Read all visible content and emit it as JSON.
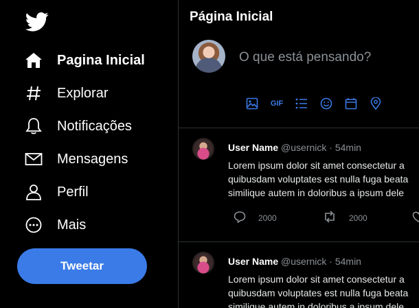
{
  "sidebar": {
    "logo": "twitter-bird-icon",
    "items": [
      {
        "label": "Pagina Inicial",
        "icon": "home-icon",
        "active": true
      },
      {
        "label": "Explorar",
        "icon": "hashtag-icon"
      },
      {
        "label": "Notificações",
        "icon": "bell-icon"
      },
      {
        "label": "Mensagens",
        "icon": "mail-icon"
      },
      {
        "label": "Perfil",
        "icon": "user-icon"
      },
      {
        "label": "Mais",
        "icon": "more-circle-icon"
      }
    ],
    "tweet_button": "Tweetar"
  },
  "main": {
    "title": "Página Inicial",
    "compose": {
      "placeholder": "O que está pensando?",
      "gif_label": "GIF",
      "icons": [
        "image-icon",
        "gif-icon",
        "list-icon",
        "emoji-icon",
        "calendar-icon",
        "location-icon"
      ]
    },
    "tweets": [
      {
        "name": "User Name",
        "handle": "@usernick · 54min",
        "lines": [
          "Lorem ipsum dolor sit amet consectetur a",
          "quibusdam voluptates est nulla fuga beata",
          "similique autem in doloribus a ipsum dele"
        ],
        "replies": "2000",
        "retweets": "2000"
      },
      {
        "name": "User Name",
        "handle": "@usernick · 54min",
        "lines": [
          "Lorem ipsum dolor sit amet consectetur a",
          "quibusdam voluptates est nulla fuga beata",
          "similique autem in doloribus a ipsum dele"
        ],
        "replies": "",
        "retweets": ""
      }
    ]
  },
  "colors": {
    "background": "#000000",
    "accent": "#3a7be8",
    "muted": "#8b9196",
    "border": "#2f3336"
  }
}
